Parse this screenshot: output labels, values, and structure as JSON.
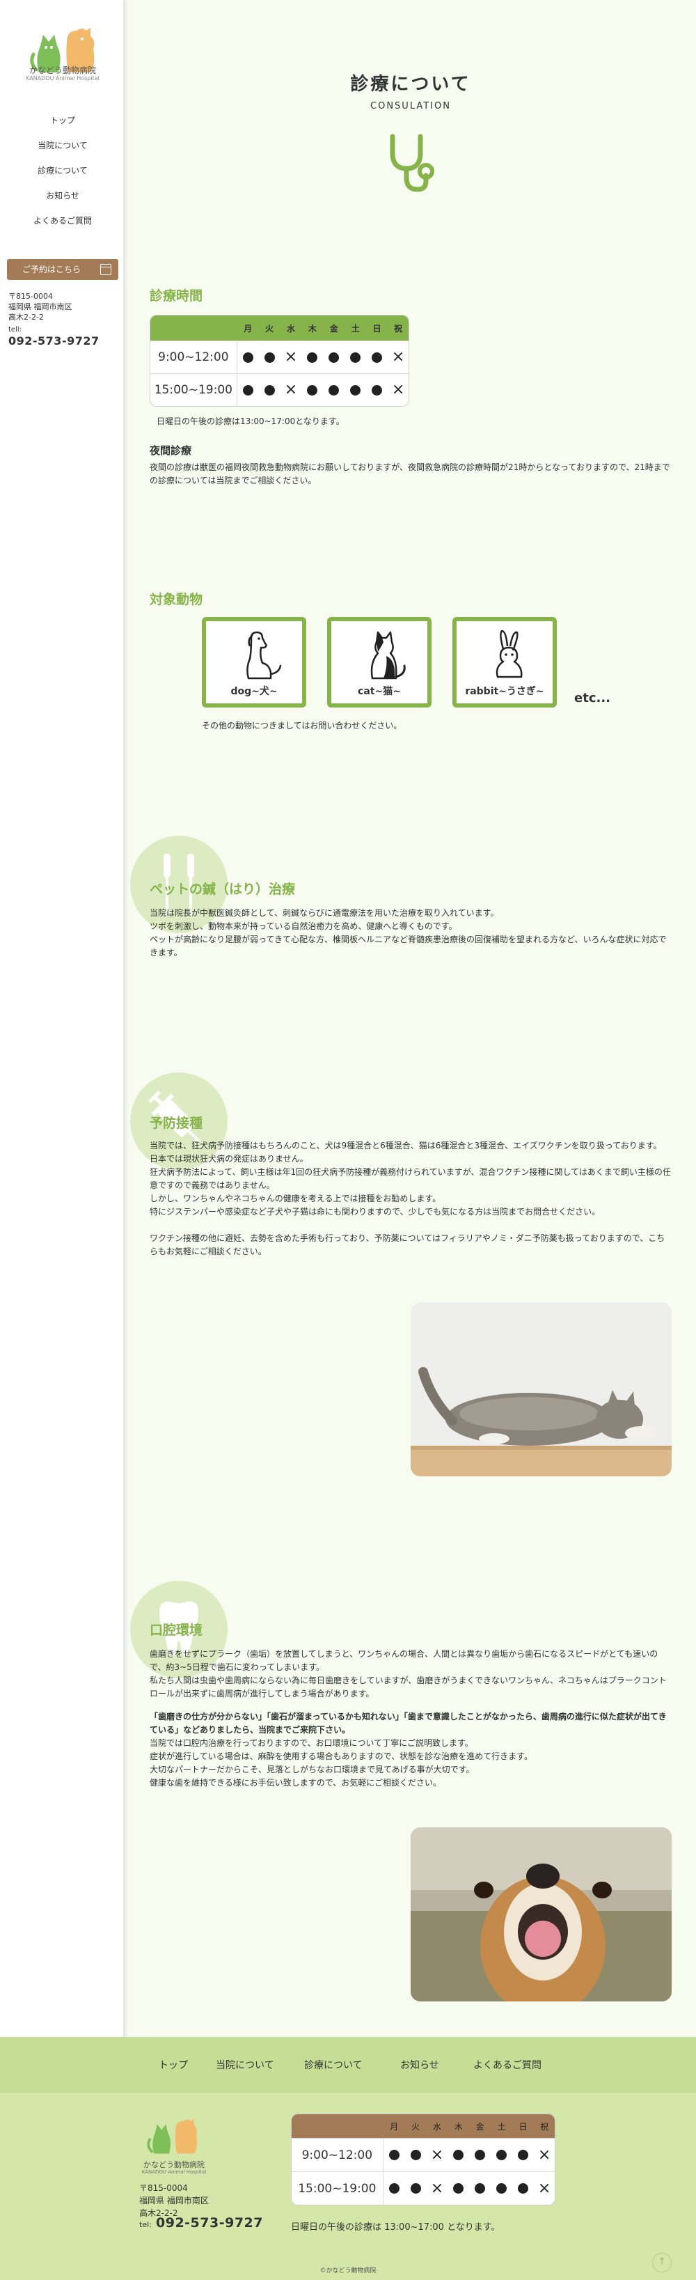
{
  "sidebar": {
    "logo_text": "かなどう動物病院",
    "logo_sub": "KANADOU Animal Hospital",
    "nav": [
      "トップ",
      "当院について",
      "診療について",
      "お知らせ",
      "よくあるご質問"
    ],
    "reserve_label": "ご予約はこちら",
    "address": [
      "〒815-0004",
      "福岡県 福岡市南区",
      "高木2-2-2"
    ],
    "tel_label": "tell:",
    "tel": "092-573-9727"
  },
  "header": {
    "title": "診療について",
    "subtitle": "CONSULATION"
  },
  "hours": {
    "heading": "診療時間",
    "days": [
      "月",
      "火",
      "水",
      "木",
      "金",
      "土",
      "日",
      "祝"
    ],
    "rows": [
      {
        "time": "9:00~12:00",
        "marks": [
          "dot",
          "dot",
          "cross",
          "dot",
          "dot",
          "dot",
          "dot",
          "cross"
        ]
      },
      {
        "time": "15:00~19:00",
        "marks": [
          "dot",
          "dot",
          "cross",
          "dot",
          "dot",
          "dot",
          "dot",
          "cross"
        ]
      }
    ],
    "note": "日曜日の午後の診療は13:00~17:00となります。",
    "night_heading": "夜間診療",
    "night_text": "夜間の診療は獣医の福岡夜間救急動物病院にお願いしておりますが、夜間救急病院の診療時間が21時からとなっておりますので、21時までの診療については当院までご相談ください。"
  },
  "animals": {
    "heading": "対象動物",
    "items": [
      {
        "label": "dog~犬~",
        "icon": "dog-icon"
      },
      {
        "label": "cat~猫~",
        "icon": "cat-icon"
      },
      {
        "label": "rabbit~うさぎ~",
        "icon": "rabbit-icon"
      }
    ],
    "etc": "etc...",
    "note": "その他の動物につきましてはお問い合わせください。"
  },
  "acupuncture": {
    "heading": "ペットの鍼（はり）治療",
    "lines": [
      "当院は院長が中獣医鍼灸師として、刺鍼ならびに通電療法を用いた治療を取り入れています。",
      "ツボを刺激し、動物本来が持っている自然治癒力を高め、健康へと導くものです。",
      "ペットが高齢になり足腰が弱ってきて心配な方、椎間板ヘルニアなど脊髄疾患治療後の回復補助を望まれる方など、いろんな症状に対応できます。"
    ]
  },
  "vaccine": {
    "heading": "予防接種",
    "lines": [
      "当院では、狂犬病予防接種はもちろんのこと、犬は9種混合と6種混合、猫は6種混合と3種混合、エイズワクチンを取り扱っております。",
      "日本では現状狂犬病の発症はありません。",
      "狂犬病予防法によって、飼い主様は年1回の狂犬病予防接種が義務付けられていますが、混合ワクチン接種に関してはあくまで飼い主様の任意ですので義務ではありません。",
      "しかし、ワンちゃんやネコちゃんの健康を考える上では接種をお勧めします。",
      "特にジステンパーや感染症など子犬や子猫は命にも関わりますので、少しでも気になる方は当院までお問合せください。",
      "ワクチン接種の他に避妊、去勢を含めた手術も行っており、予防薬についてはフィラリアやノミ・ダニ予防薬も扱っておりますので、こちらもお気軽にご相談ください。"
    ]
  },
  "dental": {
    "heading": "口腔環境",
    "lines": [
      "歯磨きをせずにプラーク（歯垢）を放置してしまうと、ワンちゃんの場合、人間とは異なり歯垢から歯石になるスピードがとても速いので、約3~5日程で歯石に変わってしまいます。",
      "私たち人間は虫歯や歯周病にならない為に毎日歯磨きをしていますが、歯磨きがうまくできないワンちゃん、ネコちゃんはプラークコントロールが出来ずに歯周病が進行してしまう場合があります。",
      "「歯磨きの仕方が分からない」「歯石が溜まっているかも知れない」「歯まで意識したことがなかったら、歯周病の進行に似た症状が出てきている」などありましたら、当院までご来院下さい。",
      "当院では口腔内治療を行っておりますので、お口環境について丁寧にご説明致します。",
      "症状が進行している場合は、麻酔を使用する場合もありますので、状態を診な治療を進めて行きます。",
      "大切なパートナーだからこそ、見落としがちなお口環境まで見てあげる事が大切です。",
      "健康な歯を維持できる様にお手伝い致しますので、お気軽にご相談ください。"
    ]
  },
  "footer": {
    "nav": [
      "トップ",
      "当院について",
      "診療について",
      "お知らせ",
      "よくあるご質問"
    ],
    "logo_text": "かなどう動物病院",
    "logo_sub": "KANADOU Animal Hospital",
    "address": [
      "〒815-0004",
      "福岡県 福岡市南区",
      "高木2-2-2"
    ],
    "tel_label": "tel:",
    "tel": "092-573-9727",
    "note": "日曜日の午後の診療は 13:00~17:00 となります。",
    "copyright": "©かなどう動物病院"
  },
  "colors": {
    "accent": "#86b44a",
    "brown": "#a37c57",
    "footer_nav": "#c5dd95",
    "footer_bg": "#d4e7a8",
    "page_bg": "#f7fbf0"
  }
}
